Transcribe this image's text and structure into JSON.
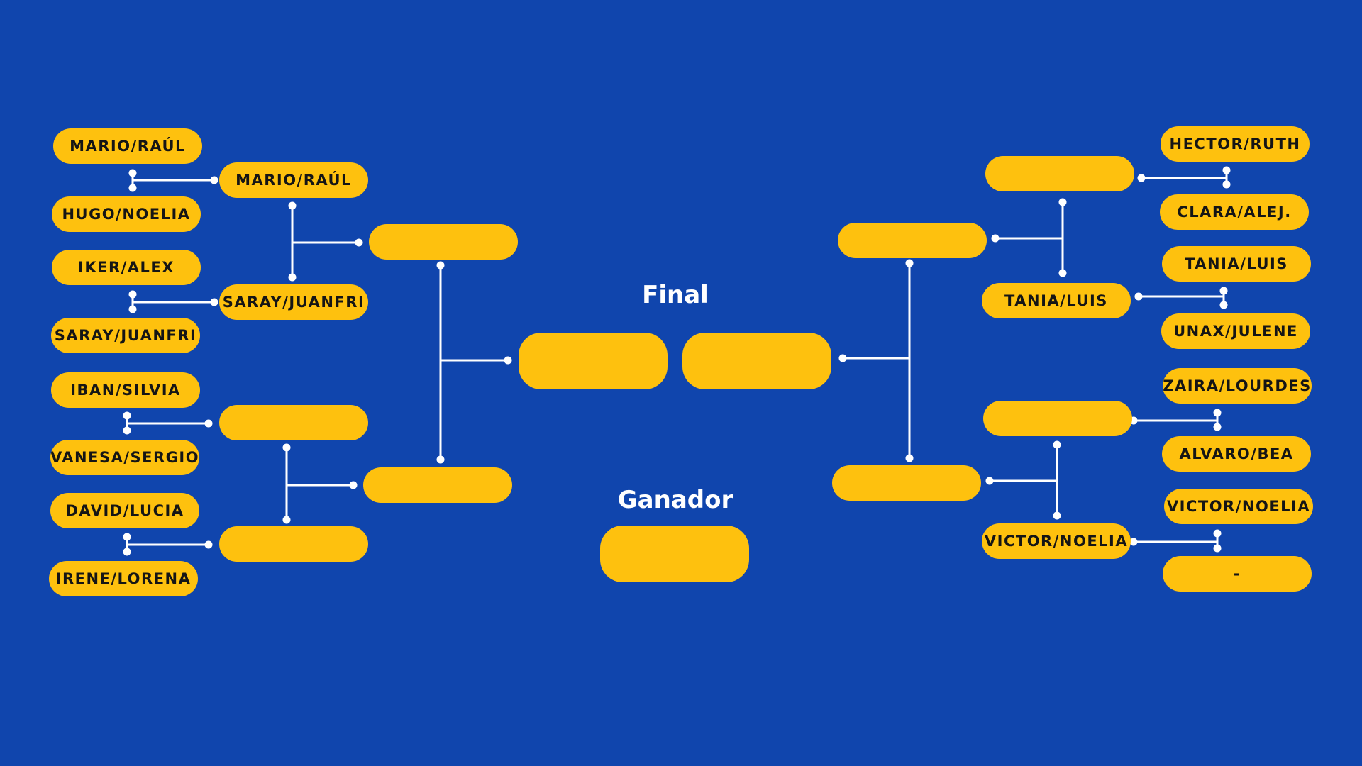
{
  "headings": {
    "final": "Final",
    "winner": "Ganador"
  },
  "colors": {
    "background": "#1045ad",
    "slot": "#fec10e",
    "text": "#151515",
    "line": "#ffffff"
  },
  "left": {
    "round1": [
      "MARIO/RAÚL",
      "HUGO/NOELIA",
      "IKER/ALEX",
      "SARAY/JUANFRI",
      "IBAN/SILVIA",
      "VANESA/SERGIO",
      "DAVID/LUCIA",
      "IRENE/LORENA"
    ],
    "round2": [
      "MARIO/RAÚL",
      "SARAY/JUANFRI",
      "",
      ""
    ],
    "semifinal": [
      "",
      ""
    ],
    "finalist": ""
  },
  "right": {
    "round1": [
      "HECTOR/RUTH",
      "CLARA/ALEJ.",
      "TANIA/LUIS",
      "UNAX/JULENE",
      "ZAIRA/LOURDES",
      "ALVARO/BEA",
      "VICTOR/NOELIA",
      "-"
    ],
    "round2": [
      "",
      "TANIA/LUIS",
      "",
      "VICTOR/NOELIA"
    ],
    "semifinal": [
      "",
      ""
    ],
    "finalist": ""
  },
  "winner": ""
}
